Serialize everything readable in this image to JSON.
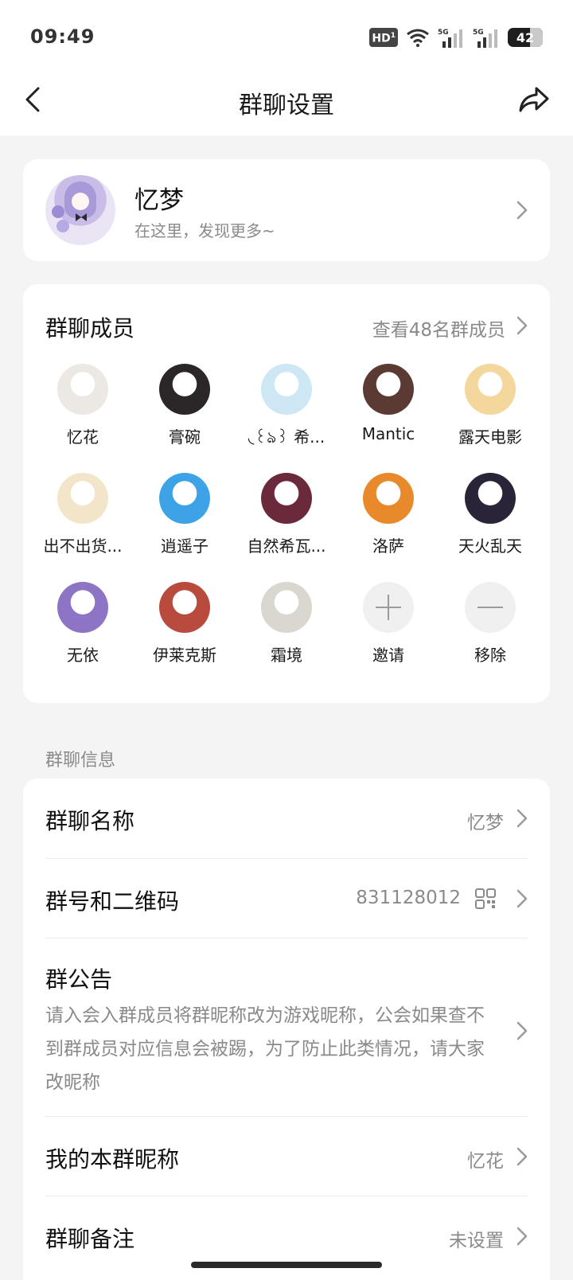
{
  "status_bar": {
    "time": "09:49",
    "battery": "42",
    "network_1": "5G",
    "network_2": "5G",
    "hd": "HD"
  },
  "nav": {
    "title": "群聊设置"
  },
  "profile": {
    "name": "忆梦",
    "subtitle": "在这里，发现更多~"
  },
  "members": {
    "title": "群聊成员",
    "view_all": "查看48名群成员",
    "list": [
      {
        "name": "忆花",
        "color": "#ece9e4"
      },
      {
        "name": "膏碗",
        "color": "#2b2627"
      },
      {
        "name": "◟꒰ঌ꒱ 希...",
        "color": "#cde7f5"
      },
      {
        "name": "Mantic",
        "color": "#5a3a32"
      },
      {
        "name": "露天电影",
        "color": "#f4d79c"
      },
      {
        "name": "出不出货...",
        "color": "#f3e5c9"
      },
      {
        "name": "逍遥子",
        "color": "#3da3e6"
      },
      {
        "name": "自然希瓦...",
        "color": "#6b2a3c"
      },
      {
        "name": "洛萨",
        "color": "#e88a2c"
      },
      {
        "name": "天火乱天",
        "color": "#2a2438"
      },
      {
        "name": "无依",
        "color": "#8e74c4"
      },
      {
        "name": "伊莱克斯",
        "color": "#b84a3e"
      },
      {
        "name": "霜境",
        "color": "#d9d7cf"
      }
    ],
    "invite_label": "邀请",
    "remove_label": "移除"
  },
  "group_info": {
    "section_label": "群聊信息",
    "name_label": "群聊名称",
    "name_value": "忆梦",
    "number_label": "群号和二维码",
    "number_value": "831128012",
    "notice_label": "群公告",
    "notice_text": "请入会入群成员将群昵称改为游戏昵称，公会如果查不到群成员对应信息会被踢，为了防止此类情况，请大家改昵称",
    "nickname_label": "我的本群昵称",
    "nickname_value": "忆花",
    "remark_label": "群聊备注",
    "remark_value": "未设置"
  }
}
